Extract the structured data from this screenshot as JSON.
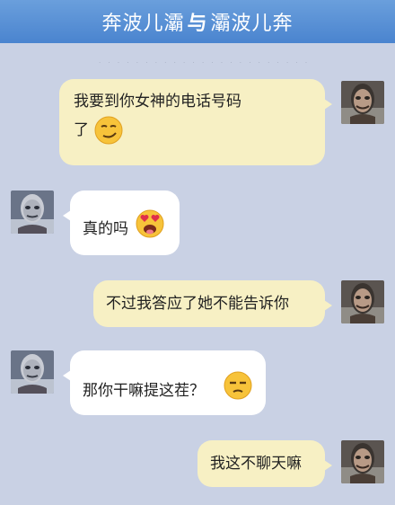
{
  "header": {
    "left": "奔波儿灞",
    "separator": "与",
    "right": "灞波儿奔"
  },
  "messages": [
    {
      "side": "right",
      "text_line1": "我要到你女神的电话号码",
      "text_line2": "了",
      "emoji": "smirk-face"
    },
    {
      "side": "left",
      "text": "真的吗",
      "emoji": "heart-eyes-face"
    },
    {
      "side": "right",
      "text": "不过我答应了她不能告诉你"
    },
    {
      "side": "left",
      "text": "那你干嘛提这茬？",
      "emoji": "unamused-face"
    },
    {
      "side": "right",
      "text": "我这不聊天嘛"
    }
  ],
  "colors": {
    "background": "#c9d1e4",
    "header": "#5a91d6",
    "right_bubble": "#f7f0c4",
    "left_bubble": "#ffffff"
  }
}
